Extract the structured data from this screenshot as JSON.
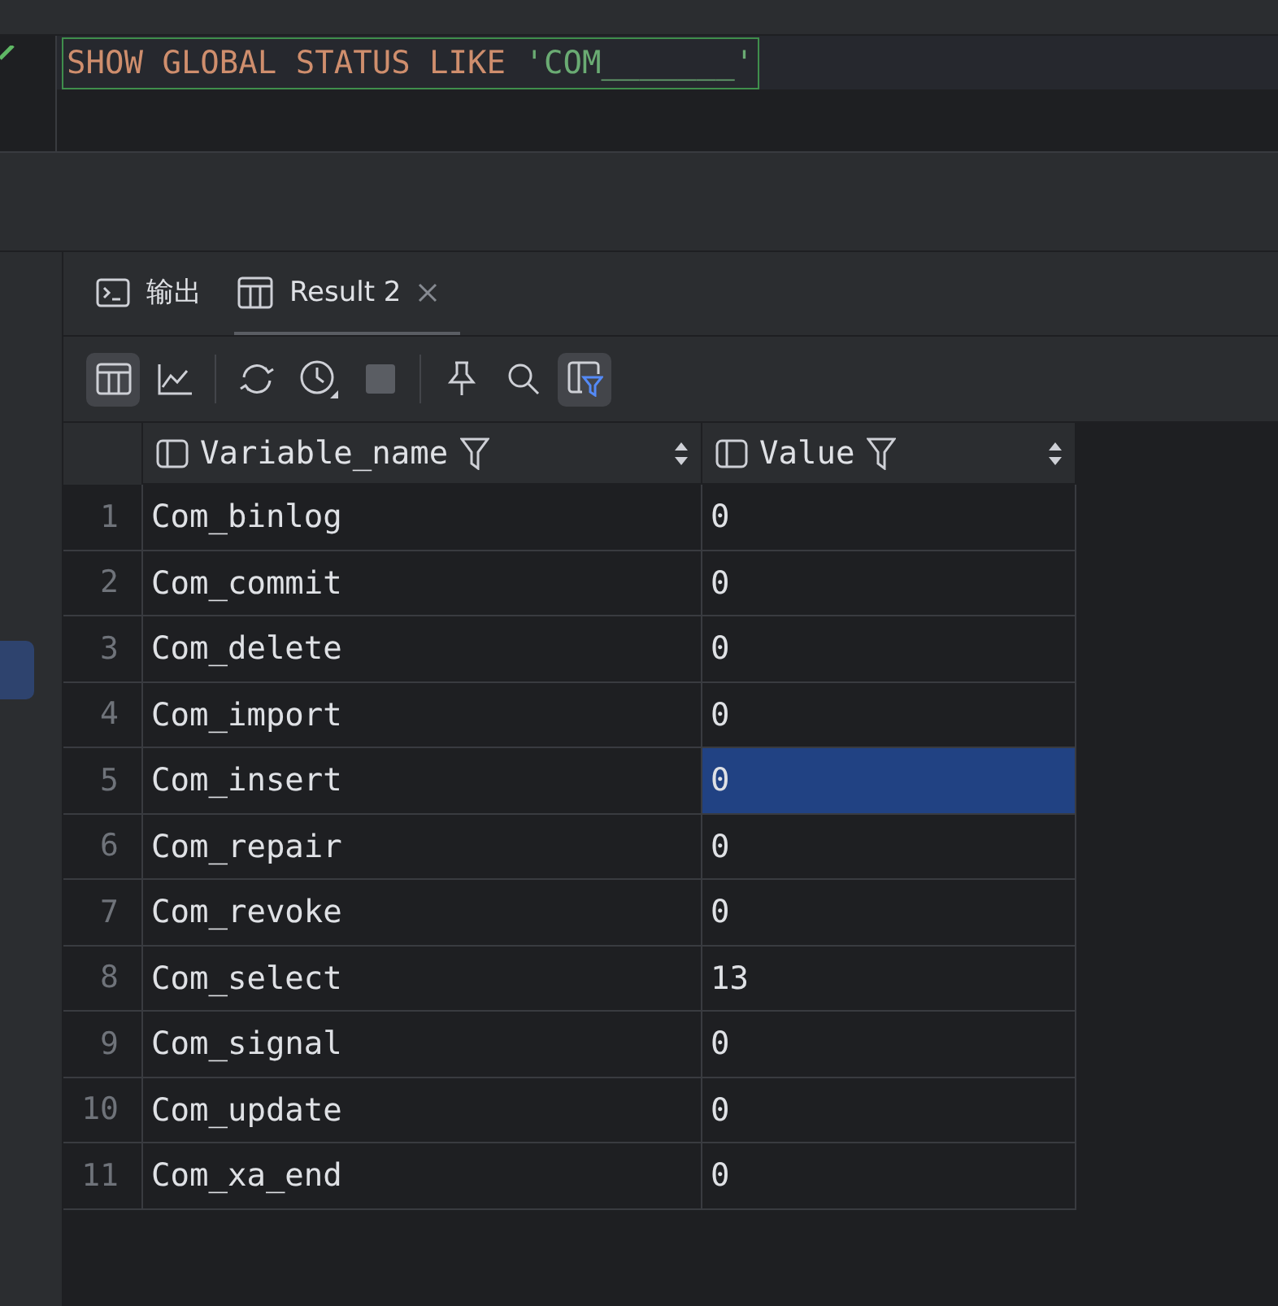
{
  "editor": {
    "line_ok": true,
    "query_keywords": "SHOW GLOBAL STATUS LIKE ",
    "query_string": "'COM_______'"
  },
  "sidebar": {
    "items": [
      {
        "selected": true
      }
    ]
  },
  "tabs": [
    {
      "kind": "console",
      "label": "输出",
      "selected": false,
      "closable": false
    },
    {
      "kind": "table",
      "label": "Result 2",
      "selected": true,
      "closable": true
    }
  ],
  "toolbar": [
    {
      "kind": "table",
      "selected": true
    },
    {
      "kind": "chart",
      "selected": false
    },
    {
      "kind": "divider"
    },
    {
      "kind": "refresh",
      "selected": false
    },
    {
      "kind": "clock",
      "selected": false
    },
    {
      "kind": "stop",
      "selected": false
    },
    {
      "kind": "divider"
    },
    {
      "kind": "pin",
      "selected": false
    },
    {
      "kind": "search",
      "selected": false
    },
    {
      "kind": "filter",
      "selected": true
    }
  ],
  "table": {
    "columns": [
      "Variable_name",
      "Value"
    ],
    "rows": [
      {
        "index": "1",
        "cells": [
          {
            "text": "Com_binlog",
            "selected": false
          },
          {
            "text": "0",
            "selected": false
          }
        ]
      },
      {
        "index": "2",
        "cells": [
          {
            "text": "Com_commit",
            "selected": false
          },
          {
            "text": "0",
            "selected": false
          }
        ]
      },
      {
        "index": "3",
        "cells": [
          {
            "text": "Com_delete",
            "selected": false
          },
          {
            "text": "0",
            "selected": false
          }
        ]
      },
      {
        "index": "4",
        "cells": [
          {
            "text": "Com_import",
            "selected": false
          },
          {
            "text": "0",
            "selected": false
          }
        ]
      },
      {
        "index": "5",
        "cells": [
          {
            "text": "Com_insert",
            "selected": false
          },
          {
            "text": "0",
            "selected": true
          }
        ]
      },
      {
        "index": "6",
        "cells": [
          {
            "text": "Com_repair",
            "selected": false
          },
          {
            "text": "0",
            "selected": false
          }
        ]
      },
      {
        "index": "7",
        "cells": [
          {
            "text": "Com_revoke",
            "selected": false
          },
          {
            "text": "0",
            "selected": false
          }
        ]
      },
      {
        "index": "8",
        "cells": [
          {
            "text": "Com_select",
            "selected": false
          },
          {
            "text": "13",
            "selected": false
          }
        ]
      },
      {
        "index": "9",
        "cells": [
          {
            "text": "Com_signal",
            "selected": false
          },
          {
            "text": "0",
            "selected": false
          }
        ]
      },
      {
        "index": "10",
        "cells": [
          {
            "text": "Com_update",
            "selected": false
          },
          {
            "text": "0",
            "selected": false
          }
        ]
      },
      {
        "index": "11",
        "cells": [
          {
            "text": "Com_xa_end",
            "selected": false
          },
          {
            "text": "0",
            "selected": false
          }
        ]
      }
    ]
  }
}
